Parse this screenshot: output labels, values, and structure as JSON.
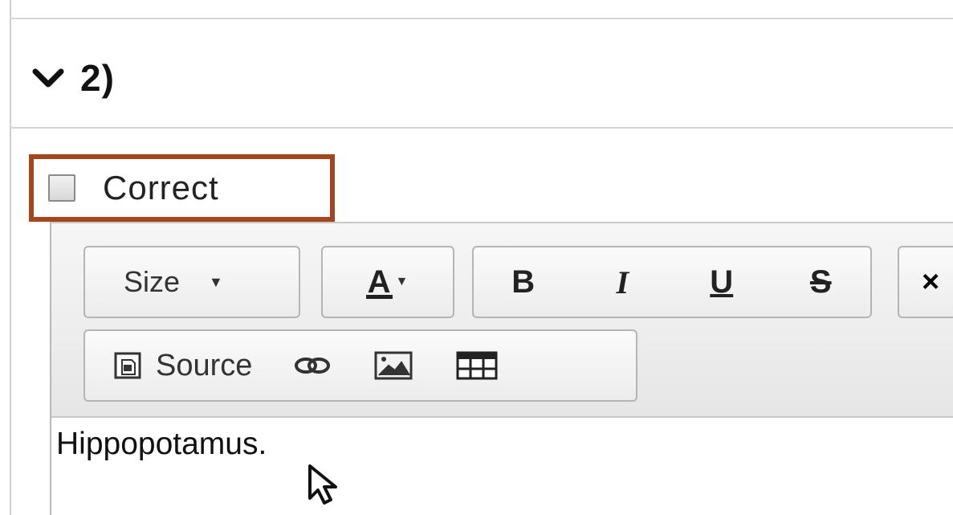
{
  "question": {
    "number_label": "2)",
    "expand_icon": "chevron-down-icon"
  },
  "answer": {
    "checkbox_label": "Correct",
    "checkbox_checked": false,
    "highlight_color": "#a3461e"
  },
  "toolbar": {
    "size_label": "Size",
    "font_color_label": "A",
    "bold_label": "B",
    "italic_label": "I",
    "underline_label": "U",
    "strike_label": "S",
    "clear_label": "×",
    "source_label": "Source",
    "icons": {
      "source": "source-code-icon",
      "link": "link-icon",
      "image": "image-icon",
      "table": "table-icon"
    }
  },
  "editor": {
    "content": "Hippopotamus."
  }
}
